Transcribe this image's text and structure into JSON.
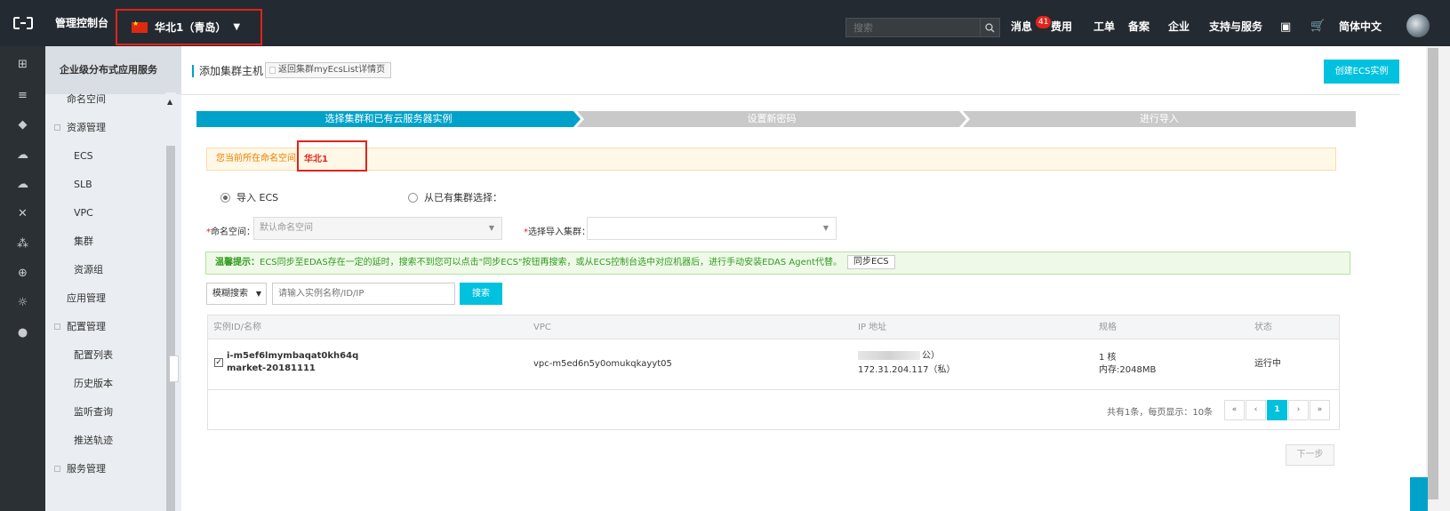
{
  "topbar": {
    "console_title": "管理控制台",
    "region": "华北1（青岛）",
    "search_placeholder": "搜索",
    "nav": [
      {
        "label": "消息",
        "badge": "41"
      },
      {
        "label": "费用"
      },
      {
        "label": "工单"
      },
      {
        "label": "备案"
      },
      {
        "label": "企业"
      },
      {
        "label": "支持与服务"
      },
      {
        "label": "简体中文"
      }
    ]
  },
  "sidebar": {
    "header": "企业级分布式应用服务",
    "items": [
      {
        "label": "命名空间",
        "level": 1
      },
      {
        "label": "资源管理",
        "level": 0
      },
      {
        "label": "ECS",
        "level": 2
      },
      {
        "label": "SLB",
        "level": 2
      },
      {
        "label": "VPC",
        "level": 2
      },
      {
        "label": "集群",
        "level": 2
      },
      {
        "label": "资源组",
        "level": 2
      },
      {
        "label": "应用管理",
        "level": 1
      },
      {
        "label": "配置管理",
        "level": 0
      },
      {
        "label": "配置列表",
        "level": 2
      },
      {
        "label": "历史版本",
        "level": 2
      },
      {
        "label": "监听查询",
        "level": 2
      },
      {
        "label": "推送轨迹",
        "level": 2
      },
      {
        "label": "服务管理",
        "level": 0
      }
    ]
  },
  "page": {
    "title": "添加集群主机",
    "back_label": "返回集群myEcsList详情页",
    "create_ecs_label": "创建ECS实例"
  },
  "steps": [
    "选择集群和已有云服务器实例",
    "设置新密码",
    "进行导入"
  ],
  "namespace_notice": {
    "prefix": "您当前所在命名空间：",
    "value": "华北1"
  },
  "import_options": {
    "ecs": "导入 ECS",
    "from_cluster": "从已有集群选择："
  },
  "form": {
    "namespace_label": "命名空间：",
    "namespace_value": "默认命名空间",
    "cluster_label": "选择导入集群："
  },
  "tip": {
    "title": "温馨提示：",
    "text": "ECS同步至EDAS存在一定的延时，搜索不到您可以点击\"同步ECS\"按钮再搜索，或从ECS控制台选中对应机器后，进行手动安装EDAS Agent代替。",
    "sync_label": "同步ECS"
  },
  "filter": {
    "type": "模糊搜索",
    "placeholder": "请输入实例名称/ID/IP",
    "search_label": "搜索"
  },
  "table": {
    "columns": [
      "实例ID/名称",
      "VPC",
      "IP 地址",
      "规格",
      "状态"
    ],
    "rows": [
      {
        "checked": true,
        "id": "i-m5ef6lmymbaqat0kh64q",
        "name": "market-20181111",
        "vpc": "vpc-m5ed6n5y0omukqkayyt05",
        "ip_public_suffix": "公）",
        "ip_private": "172.31.204.117（私）",
        "spec_cpu": "1 核",
        "spec_mem": "内存:2048MB",
        "status": "运行中"
      }
    ],
    "pagination": {
      "info": "共有1条，每页显示：10条",
      "first": "«",
      "prev": "‹",
      "current": "1",
      "next": "›",
      "last": "»"
    }
  },
  "next_label": "下一步",
  "colors": {
    "accent": "#00c1de",
    "highlight": "#e2231a",
    "topbar": "#242a31"
  }
}
